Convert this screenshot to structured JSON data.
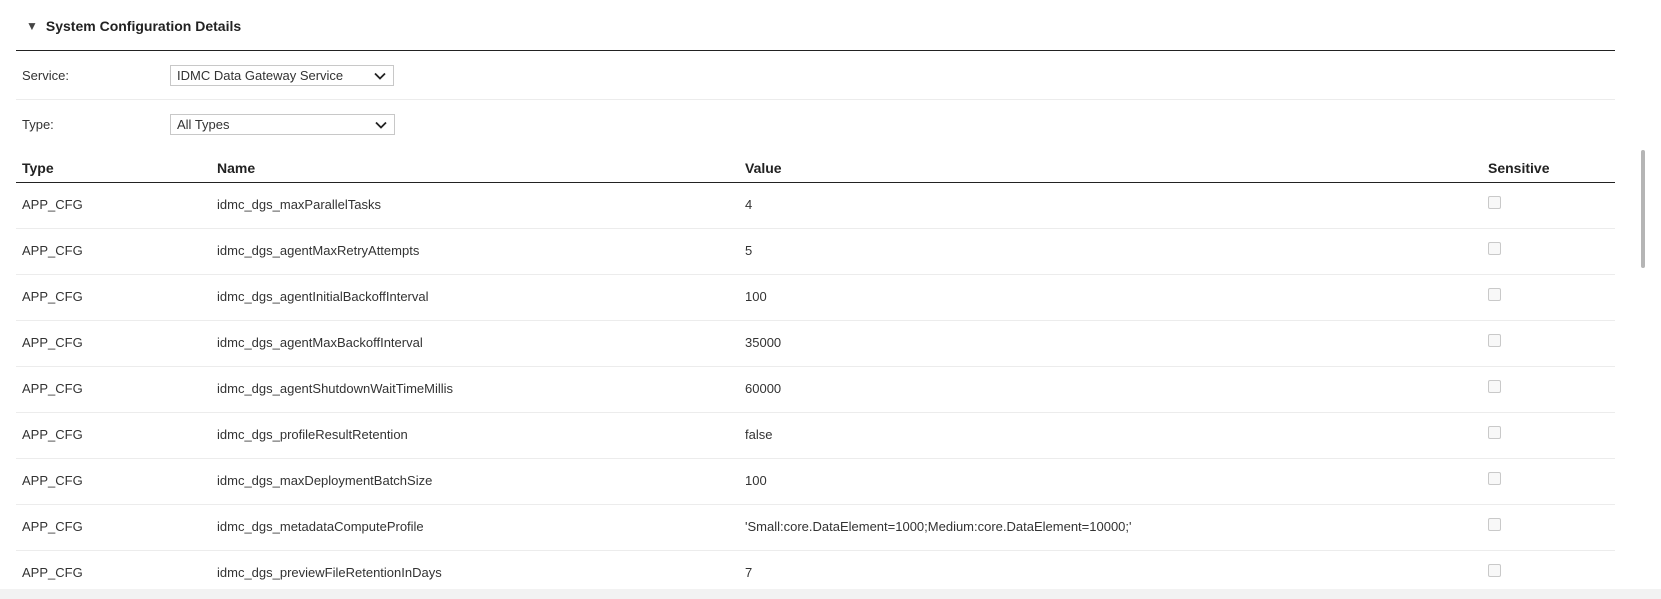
{
  "section": {
    "title": "System Configuration Details",
    "collapse_icon": "triangle-down-icon",
    "expanded": true
  },
  "filters": {
    "service": {
      "label": "Service:",
      "value": "IDMC Data Gateway Service"
    },
    "type": {
      "label": "Type:",
      "value": "All Types"
    }
  },
  "table": {
    "columns": {
      "type": "Type",
      "name": "Name",
      "value": "Value",
      "sensitive": "Sensitive"
    },
    "rows": [
      {
        "type": "APP_CFG",
        "name": "idmc_dgs_maxParallelTasks",
        "value": "4",
        "sensitive": false
      },
      {
        "type": "APP_CFG",
        "name": "idmc_dgs_agentMaxRetryAttempts",
        "value": "5",
        "sensitive": false
      },
      {
        "type": "APP_CFG",
        "name": "idmc_dgs_agentInitialBackoffInterval",
        "value": "100",
        "sensitive": false
      },
      {
        "type": "APP_CFG",
        "name": "idmc_dgs_agentMaxBackoffInterval",
        "value": "35000",
        "sensitive": false
      },
      {
        "type": "APP_CFG",
        "name": "idmc_dgs_agentShutdownWaitTimeMillis",
        "value": "60000",
        "sensitive": false
      },
      {
        "type": "APP_CFG",
        "name": "idmc_dgs_profileResultRetention",
        "value": "false",
        "sensitive": false
      },
      {
        "type": "APP_CFG",
        "name": "idmc_dgs_maxDeploymentBatchSize",
        "value": "100",
        "sensitive": false
      },
      {
        "type": "APP_CFG",
        "name": "idmc_dgs_metadataComputeProfile",
        "value": "'Small:core.DataElement=1000;Medium:core.DataElement=10000;'",
        "sensitive": false
      },
      {
        "type": "APP_CFG",
        "name": "idmc_dgs_previewFileRetentionInDays",
        "value": "7",
        "sensitive": false
      }
    ]
  },
  "colors": {
    "text": "#222222",
    "divider": "#ececec",
    "header_rule": "#222222"
  }
}
